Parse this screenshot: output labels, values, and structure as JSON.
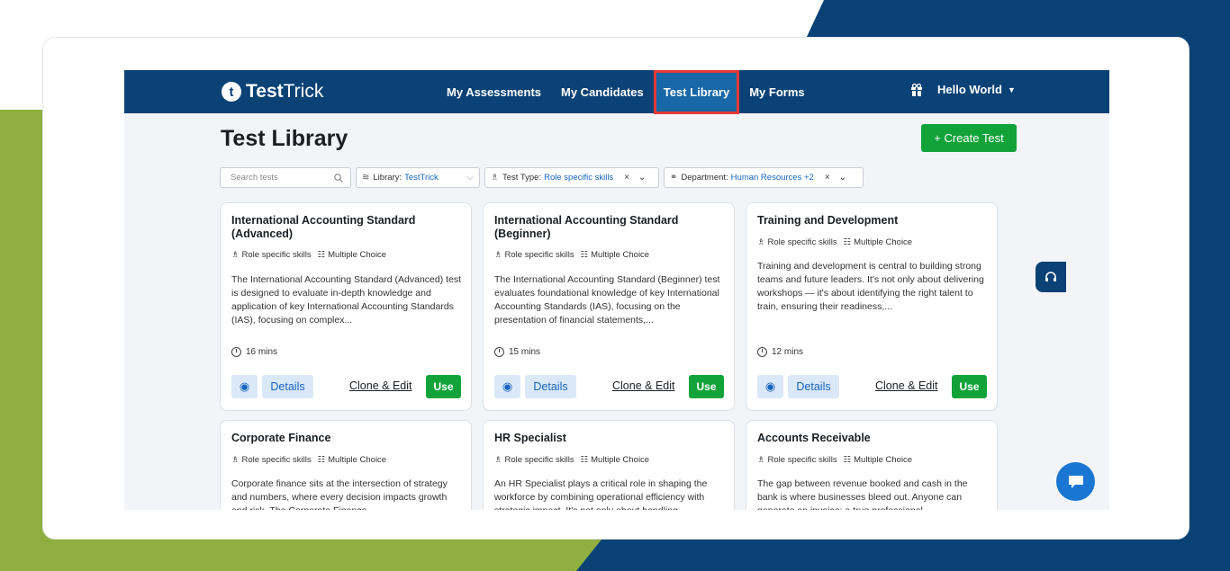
{
  "colors": {
    "navbar": "#0b4275",
    "accent_green": "#11a33a",
    "link_blue": "#1565c0",
    "highlight_red": "#e53935",
    "bg_olive": "#8fb040"
  },
  "brand": {
    "name_bold": "Test",
    "name_regular": "Trick",
    "icon": "t-logo-icon"
  },
  "nav": {
    "links": [
      "My Assessments",
      "My Candidates",
      "Test Library",
      "My Forms"
    ],
    "active": "Test Library",
    "user": "Hello World",
    "gift_icon": "gift-icon"
  },
  "page": {
    "title": "Test Library",
    "create_label": "+ Create Test"
  },
  "filters": {
    "search_placeholder": "Search tests",
    "library_label": "Library:",
    "library_value": "TestTrick",
    "type_label": "Test Type:",
    "type_value": "Role specific skills",
    "dept_label": "Department:",
    "dept_value": "Human Resources +2"
  },
  "cards": [
    {
      "title": "International Accounting Standard (Advanced)",
      "category": "Role specific skills",
      "format": "Multiple Choice",
      "description": "The International Accounting Standard (Advanced) test is designed to evaluate in-depth knowledge and application of key International Accounting Standards (IAS), focusing on complex...",
      "duration": "16 mins"
    },
    {
      "title": "International Accounting Standard (Beginner)",
      "category": "Role specific skills",
      "format": "Multiple Choice",
      "description": "The International Accounting Standard (Beginner) test evaluates foundational knowledge of key International Accounting Standards (IAS), focusing on the presentation of financial statements,...",
      "duration": "15 mins"
    },
    {
      "title": "Training and Development",
      "category": "Role specific skills",
      "format": "Multiple Choice",
      "description": "Training and development is central to building strong teams and future leaders. It's not only about delivering workshops — it's about identifying the right talent to train, ensuring their readiness,...",
      "duration": "12 mins"
    },
    {
      "title": "Corporate Finance",
      "category": "Role specific skills",
      "format": "Multiple Choice",
      "description": "Corporate finance sits at the intersection of strategy and numbers, where every decision impacts growth and risk. The Corporate Finance"
    },
    {
      "title": "HR Specialist",
      "category": "Role specific skills",
      "format": "Multiple Choice",
      "description": "An HR Specialist plays a critical role in shaping the workforce by combining operational efficiency with strategic impact. It's not only about handling"
    },
    {
      "title": "Accounts Receivable",
      "category": "Role specific skills",
      "format": "Multiple Choice",
      "description": "The gap between revenue booked and cash in the bank is where businesses bleed out. Anyone can generate an invoice; a true professional"
    }
  ],
  "card_actions": {
    "details": "Details",
    "clone": "Clone & Edit",
    "use": "Use"
  }
}
